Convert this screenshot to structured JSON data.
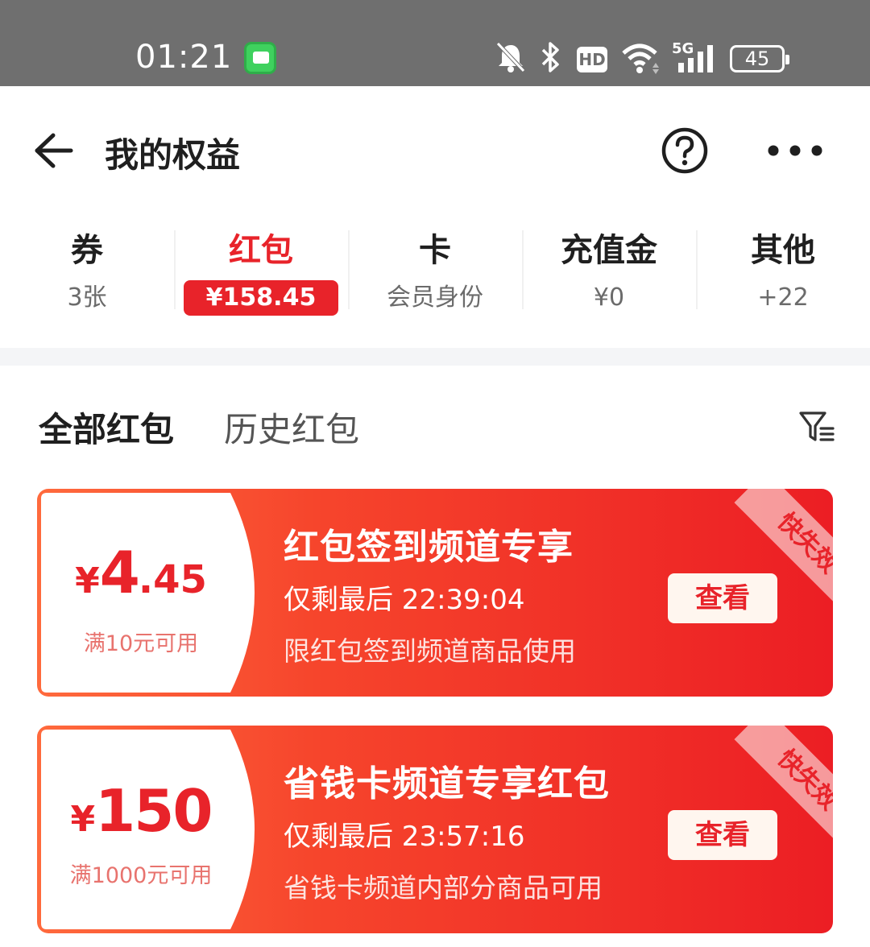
{
  "status_bar": {
    "time": "01:21",
    "battery": "45",
    "network": "5G",
    "hd_label": "HD"
  },
  "header": {
    "title": "我的权益"
  },
  "categories": [
    {
      "title": "券",
      "sub": "3张"
    },
    {
      "title": "红包",
      "sub": "¥158.45"
    },
    {
      "title": "卡",
      "sub": "会员身份"
    },
    {
      "title": "充值金",
      "sub": "¥0"
    },
    {
      "title": "其他",
      "sub": "+22"
    }
  ],
  "sub_tabs": {
    "all": "全部红包",
    "history": "历史红包"
  },
  "coupons": [
    {
      "currency": "¥",
      "amount_int": "4",
      "amount_dec": ".45",
      "condition": "满10元可用",
      "title": "红包签到频道专享",
      "timer": "仅剩最后 22:39:04",
      "desc": "限红包签到频道商品使用",
      "button": "查看",
      "tag": "快失效"
    },
    {
      "currency": "¥",
      "amount_int": "150",
      "amount_dec": "",
      "condition": "满1000元可用",
      "title": "省钱卡频道专享红包",
      "timer": "仅剩最后 23:57:16",
      "desc": "省钱卡频道内部分商品可用",
      "button": "查看",
      "tag": "快失效"
    }
  ],
  "colors": {
    "accent": "#e8232a",
    "card_gradient_start": "#ff6a3d",
    "card_gradient_end": "#ec1e24",
    "status_bar": "#6f6f6f"
  }
}
